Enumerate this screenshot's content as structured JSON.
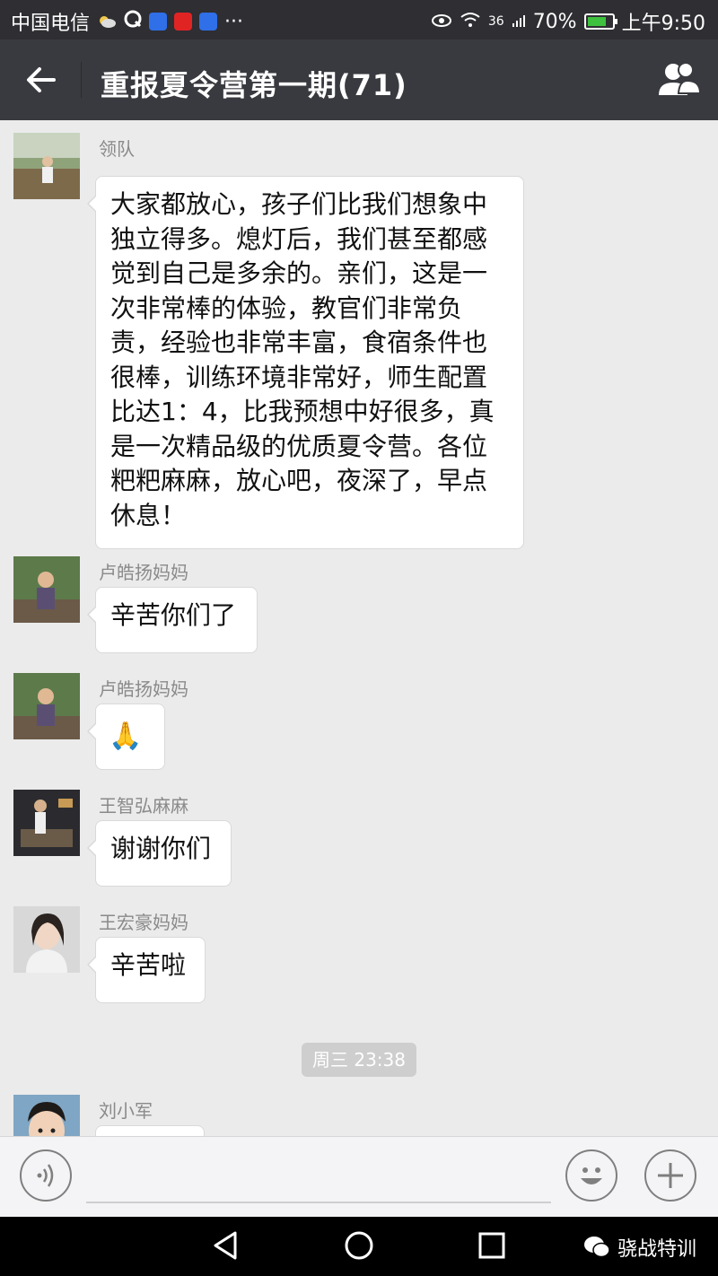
{
  "status_bar": {
    "carrier": "中国电信",
    "network": "36",
    "battery": "70%",
    "battery_level": 0.7,
    "time": "上午9:50",
    "colors": {
      "background": "#2e2e33",
      "battery_fill": "#3ec13e"
    }
  },
  "header": {
    "title": "重报夏令营第一期(71)",
    "back_icon": "back-arrow-icon",
    "members_icon": "group-members-icon",
    "background": "#393a3f"
  },
  "messages": [
    {
      "sender": "领队",
      "text": "大家都放心，孩子们比我们想象中独立得多。熄灯后，我们甚至都感觉到自己是多余的。亲们，这是一次非常棒的体验，教官们非常负责，经验也非常丰富，食宿条件也很棒，训练环境非常好，师生配置比达1：4，比我预想中好很多，真是一次精品级的优质夏令营。各位粑粑麻麻，放心吧，夜深了，早点休息！"
    },
    {
      "sender": "卢皓扬妈妈",
      "text": "辛苦你们了"
    },
    {
      "sender": "卢皓扬妈妈",
      "text": "🙏"
    },
    {
      "sender": "王智弘麻麻",
      "text": "谢谢你们"
    },
    {
      "sender": "王宏豪妈妈",
      "text": "辛苦啦"
    },
    {
      "sender": "刘小军",
      "text": ""
    }
  ],
  "timestamp": "周三 23:38",
  "input_bar": {
    "voice_icon": "voice-icon",
    "emoji_icon": "emoji-icon",
    "plus_icon": "plus-icon"
  },
  "nav_bar": {
    "back_icon": "nav-back-icon",
    "home_icon": "nav-home-icon",
    "recents_icon": "nav-recents-icon",
    "watermark": "骁战特训"
  },
  "colors": {
    "chat_background": "#ebebeb",
    "bubble": "#ffffff",
    "sender_name": "#8a8a8a"
  }
}
